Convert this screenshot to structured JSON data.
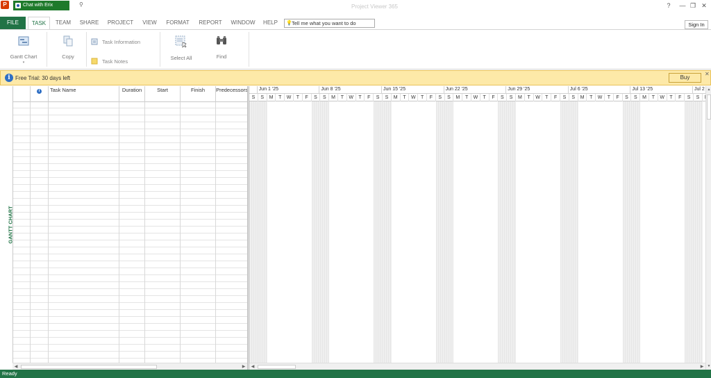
{
  "titlebar": {
    "chat_tab": "Chat with Erix",
    "window_title": "Project Viewer 365",
    "help": "?",
    "minimize": "—",
    "restore": "❐",
    "close": "✕"
  },
  "tabs": {
    "file": "FILE",
    "task": "TASK",
    "team": "TEAM",
    "share": "SHARE",
    "project": "PROJECT",
    "view": "VIEW",
    "format": "FORMAT",
    "report": "REPORT",
    "window": "WINDOW",
    "help": "HELP",
    "tell_me": "Tell me what you want to do",
    "sign_in": "Sign In"
  },
  "ribbon": {
    "gantt_chart": "Gantt Chart",
    "copy": "Copy",
    "task_information": "Task Information",
    "task_notes": "Task Notes",
    "select_all": "Select All",
    "find": "Find"
  },
  "trial": {
    "message": "Free Trial: 30 days left",
    "buy": "Buy",
    "close": "✕"
  },
  "side_label": "GANTT CHART",
  "grid": {
    "columns": [
      "",
      "",
      "Task Name",
      "Duration",
      "Start",
      "Finish",
      "Predecessors"
    ]
  },
  "timeline": {
    "weeks": [
      "Jun 1 '25",
      "Jun 8 '25",
      "Jun 15 '25",
      "Jun 22 '25",
      "Jun 29 '25",
      "Jul 6 '25",
      "Jul 13 '25",
      "Jul 2"
    ],
    "days": [
      "S",
      "S",
      "M",
      "T",
      "W",
      "T",
      "F"
    ]
  },
  "status": {
    "text": "Ready"
  },
  "colors": {
    "accent": "#217346",
    "trial_bg": "#fde9a8",
    "info_blue": "#2f6fc4"
  }
}
